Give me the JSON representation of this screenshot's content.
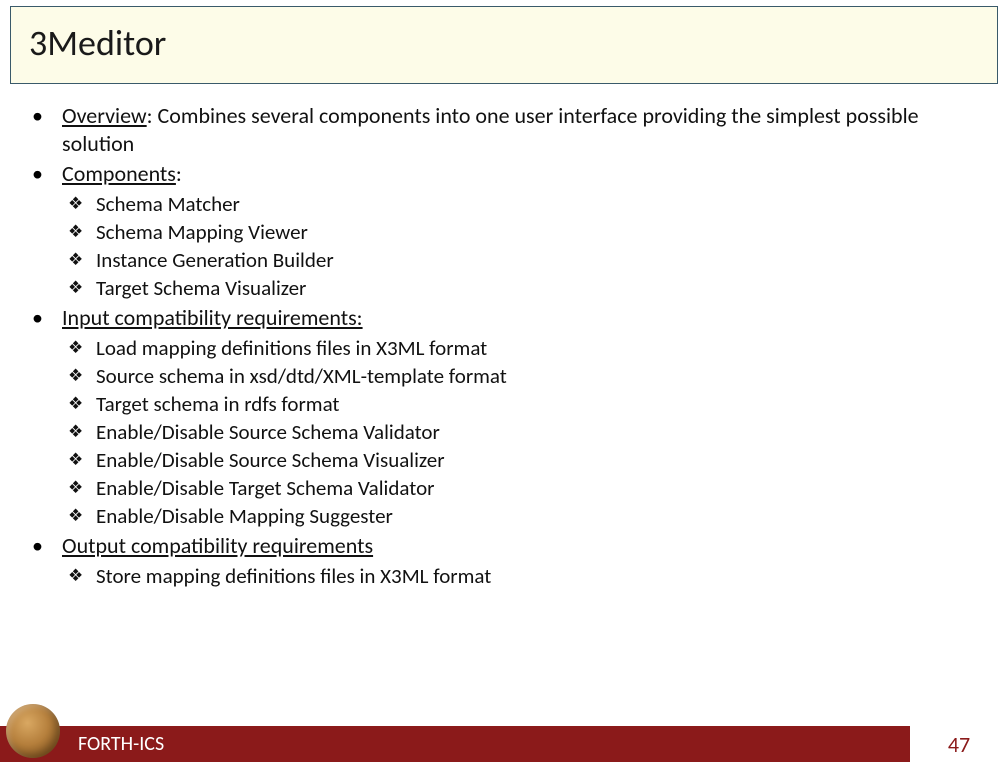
{
  "title": "3Meditor",
  "sections": [
    {
      "label": "Overview",
      "text": ": Combines several components into one user interface providing the simplest possible solution",
      "items": []
    },
    {
      "label": "Components",
      "text": ":",
      "items": [
        "Schema Matcher",
        "Schema Mapping Viewer",
        "Instance Generation Builder",
        "Target Schema Visualizer"
      ]
    },
    {
      "label": "Input compatibility requirements:",
      "text": "",
      "items": [
        "Load mapping definitions files in X3ML format",
        "Source schema in xsd/dtd/XML-template format",
        "Target schema in rdfs format",
        "Enable/Disable Source Schema Validator",
        "Enable/Disable Source Schema Visualizer",
        "Enable/Disable Target Schema Validator",
        "Enable/Disable Mapping Suggester"
      ]
    },
    {
      "label": "Output compatibility requirements",
      "text": "",
      "items": [
        "Store mapping definitions files in X3ML format"
      ]
    }
  ],
  "footer": {
    "org": "FORTH-ICS",
    "page": "47"
  }
}
